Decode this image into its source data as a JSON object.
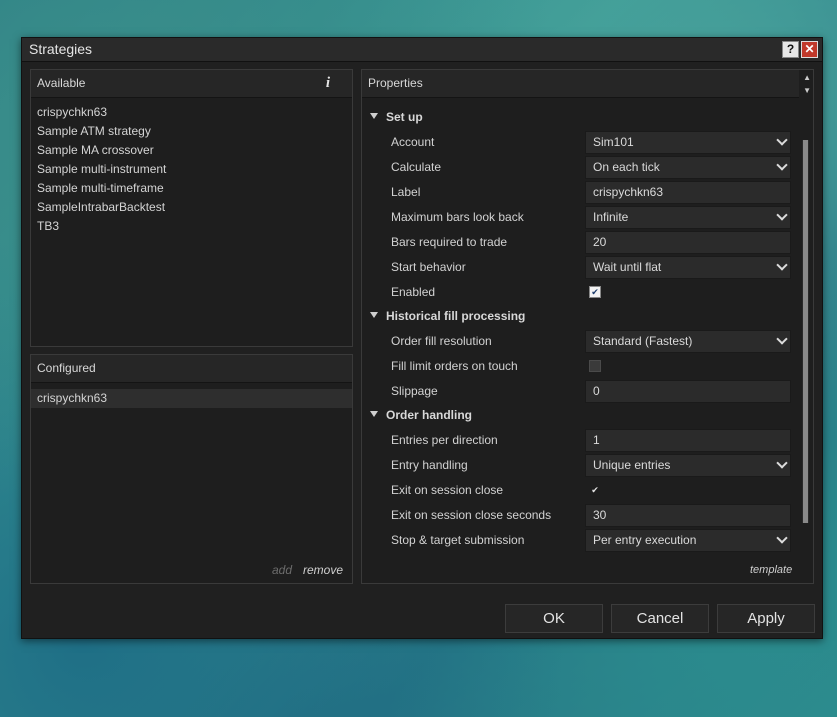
{
  "window": {
    "title": "Strategies"
  },
  "available": {
    "header": "Available",
    "items": [
      "crispychkn63",
      "Sample ATM strategy",
      "Sample MA crossover",
      "Sample multi-instrument",
      "Sample multi-timeframe",
      "SampleIntrabarBacktest",
      "TB3"
    ]
  },
  "configured": {
    "header": "Configured",
    "items": [
      "crispychkn63"
    ],
    "add_label": "add",
    "remove_label": "remove"
  },
  "properties": {
    "header": "Properties",
    "template_label": "template",
    "sections": [
      {
        "label": "Set up",
        "rows": [
          {
            "label": "Account",
            "type": "select",
            "value": "Sim101"
          },
          {
            "label": "Calculate",
            "type": "select",
            "value": "On each tick"
          },
          {
            "label": "Label",
            "type": "text",
            "value": "crispychkn63"
          },
          {
            "label": "Maximum bars look back",
            "type": "select",
            "value": "Infinite"
          },
          {
            "label": "Bars required to trade",
            "type": "text",
            "value": "20"
          },
          {
            "label": "Start behavior",
            "type": "select",
            "value": "Wait until flat"
          },
          {
            "label": "Enabled",
            "type": "checkbox",
            "checked": true
          }
        ]
      },
      {
        "label": "Historical fill processing",
        "rows": [
          {
            "label": "Order fill resolution",
            "type": "select",
            "value": "Standard (Fastest)"
          },
          {
            "label": "Fill limit orders on touch",
            "type": "checkbox",
            "checked": false
          },
          {
            "label": "Slippage",
            "type": "text",
            "value": "0"
          }
        ]
      },
      {
        "label": "Order handling",
        "rows": [
          {
            "label": "Entries per direction",
            "type": "text",
            "value": "1"
          },
          {
            "label": "Entry handling",
            "type": "select",
            "value": "Unique entries"
          },
          {
            "label": "Exit on session close",
            "type": "checkbox",
            "checked": true
          },
          {
            "label": "Exit on session close seconds",
            "type": "text",
            "value": "30"
          },
          {
            "label": "Stop & target submission",
            "type": "select",
            "value": "Per entry execution"
          }
        ]
      }
    ]
  },
  "buttons": {
    "ok": "OK",
    "cancel": "Cancel",
    "apply": "Apply"
  },
  "icons": {
    "info": "info-icon",
    "help": "help-icon",
    "close": "close-icon",
    "checkbox_mark": "✔"
  }
}
